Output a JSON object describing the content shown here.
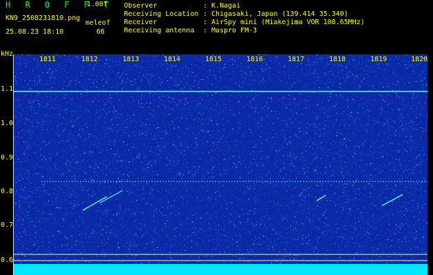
{
  "header": {
    "app_title": "H R O F F T",
    "version": "1.00f",
    "file_name": "KN9_2508231810.png",
    "datetime": "25.08.23 18:10",
    "meleof_label": "meleof",
    "count": "66"
  },
  "info": [
    {
      "label": "Observer",
      "value": ": K.Nagai"
    },
    {
      "label": "Receiving Location",
      "value": ": Chigasaki, Japan (139.414 35.340)"
    },
    {
      "label": "Receiver",
      "value": ": AirSpy mini (Miakejima VOR 108.65MHz)"
    },
    {
      "label": "Receiving antenna",
      "value": ": Maspro FM-3"
    }
  ],
  "spectrogram": {
    "unit_label": "kHz",
    "freq_ticks": [
      "1.1",
      "1.0",
      "0.9",
      "0.8",
      "0.7",
      "0.6"
    ],
    "time_ticks": [
      "1811",
      "1812",
      "1813",
      "1814",
      "1815",
      "1816",
      "1817",
      "1818",
      "1819",
      "1820"
    ],
    "colors": {
      "background": "#0b2aa8",
      "noise": "#2a6cff",
      "signal": "#4dfff0",
      "axis": "#ffff00",
      "bottom_band": "#00e8ff"
    }
  }
}
